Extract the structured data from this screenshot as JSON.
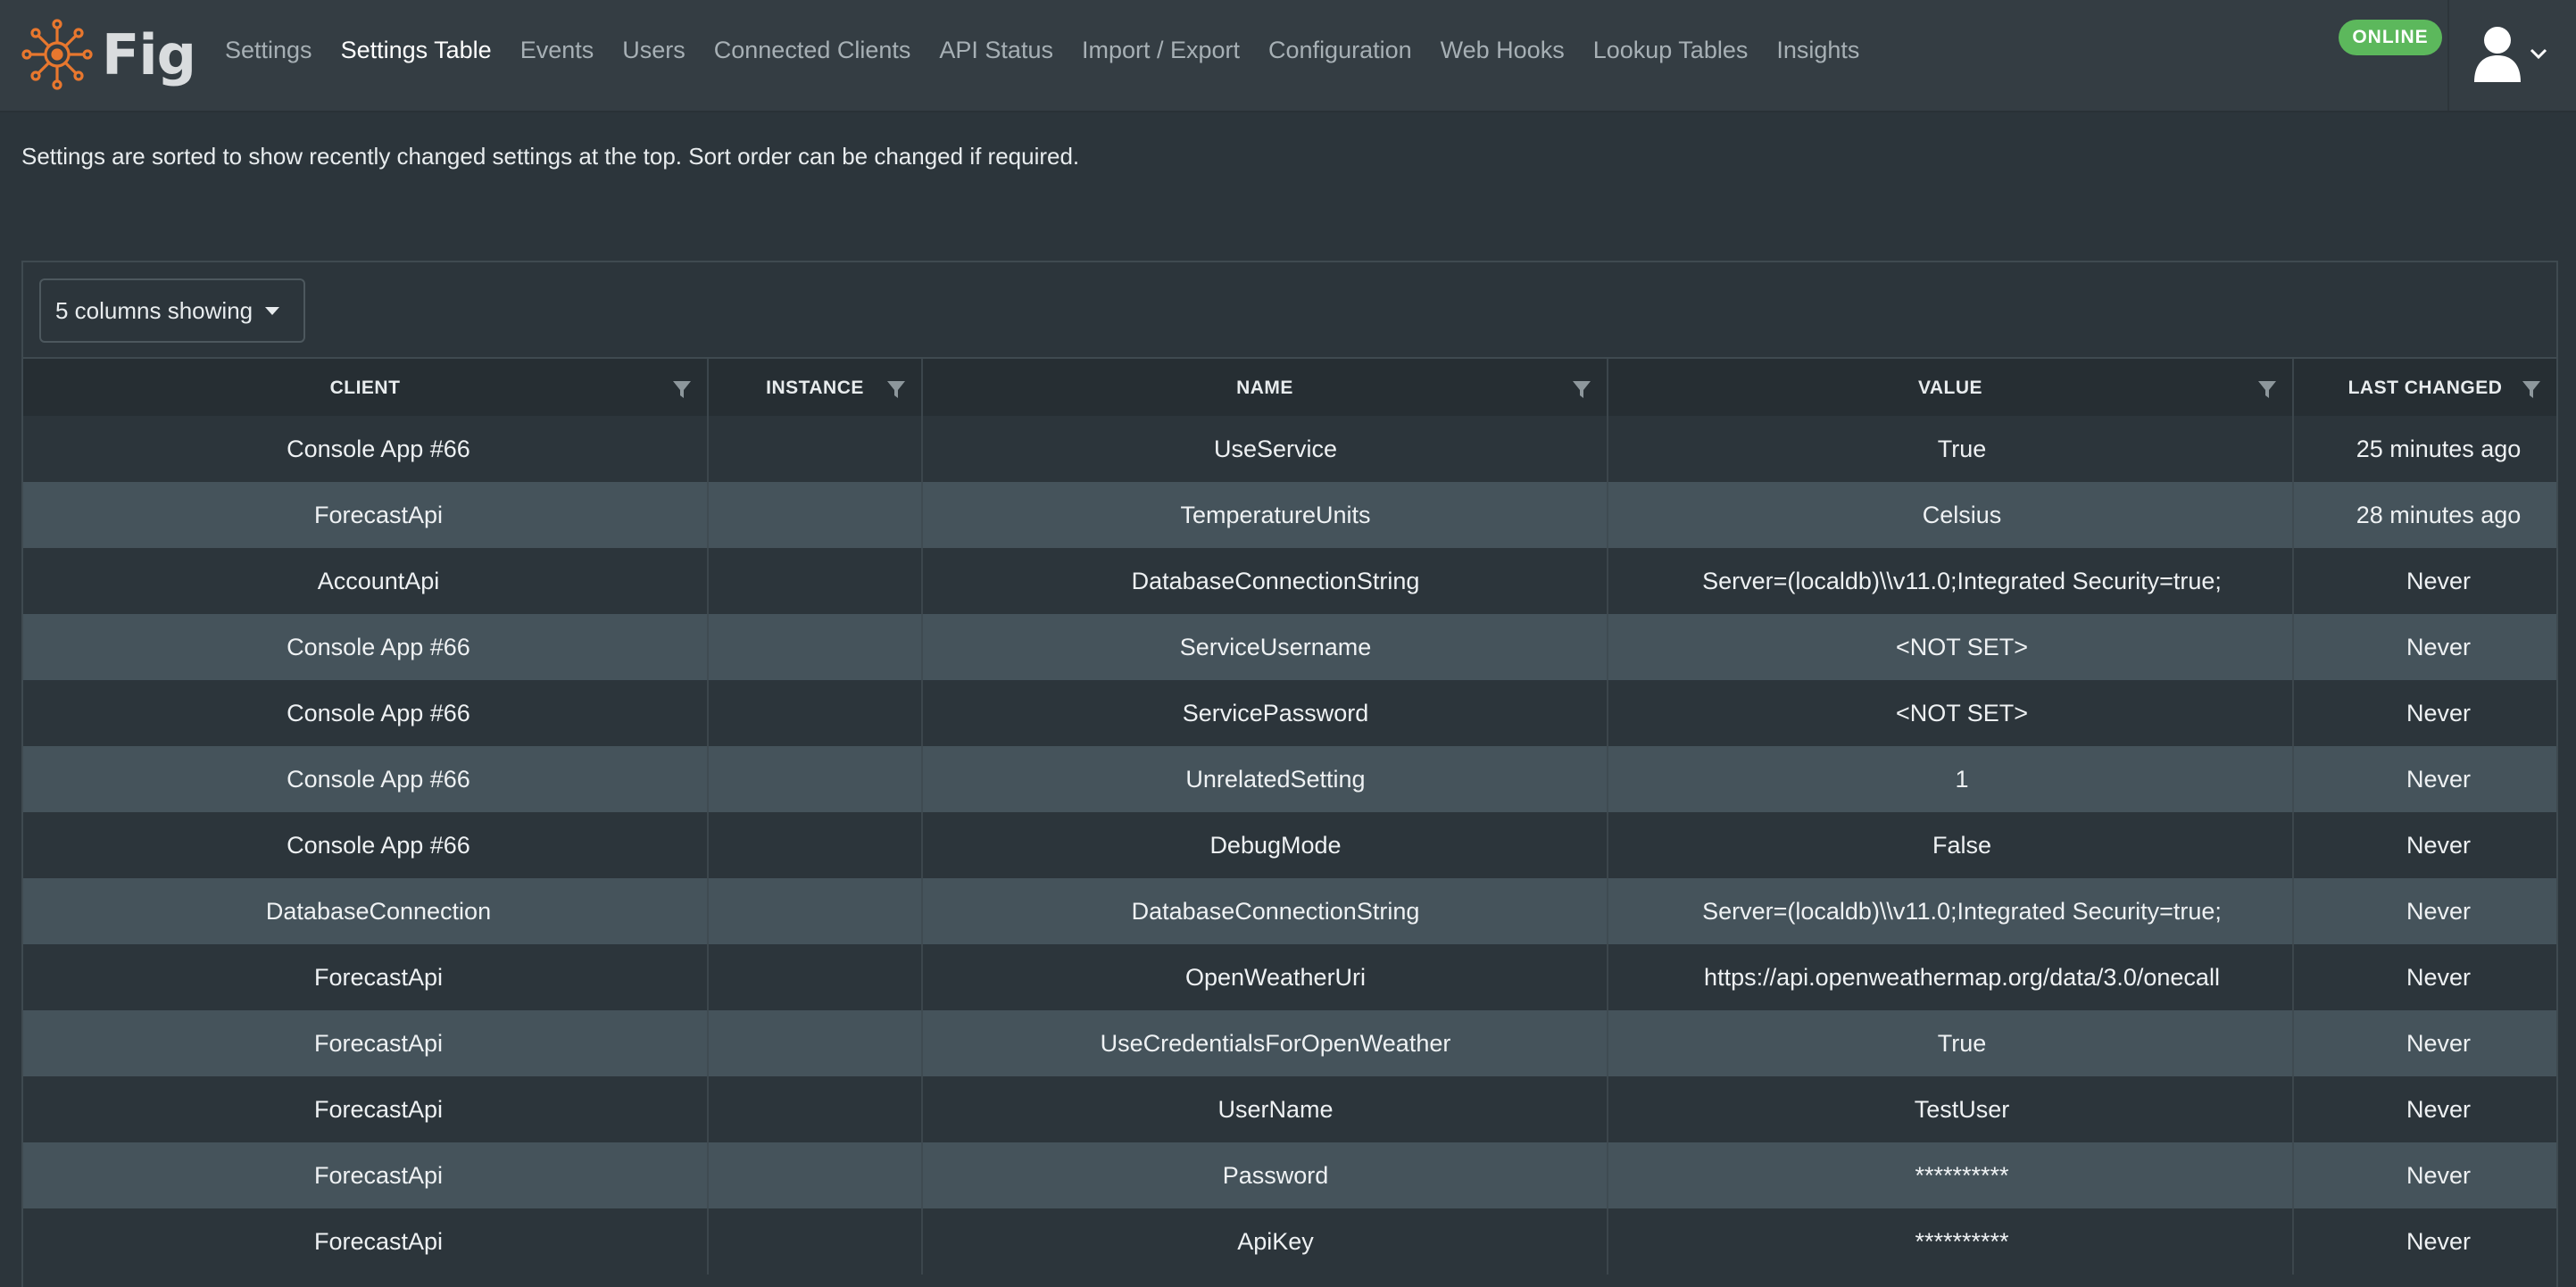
{
  "app": {
    "name": "Fig",
    "accent_color": "#e8772e",
    "status": "ONLINE",
    "status_color": "#5cb85c"
  },
  "nav": {
    "items": [
      {
        "label": "Settings",
        "active": false
      },
      {
        "label": "Settings Table",
        "active": true
      },
      {
        "label": "Events",
        "active": false
      },
      {
        "label": "Users",
        "active": false
      },
      {
        "label": "Connected Clients",
        "active": false
      },
      {
        "label": "API Status",
        "active": false
      },
      {
        "label": "Import / Export",
        "active": false
      },
      {
        "label": "Configuration",
        "active": false
      },
      {
        "label": "Web Hooks",
        "active": false
      },
      {
        "label": "Lookup Tables",
        "active": false
      },
      {
        "label": "Insights",
        "active": false
      }
    ]
  },
  "user_menu": {
    "icon": "user-icon",
    "chevron": "chevron-down-icon"
  },
  "info_text": "Settings are sorted to show recently changed settings at the top. Sort order can be changed if required.",
  "table": {
    "columns_toggle_label": "5 columns showing",
    "headers": [
      "CLIENT",
      "INSTANCE",
      "NAME",
      "VALUE",
      "LAST CHANGED"
    ],
    "rows": [
      [
        "Console App #66",
        "",
        "UseService",
        "True",
        "25 minutes ago"
      ],
      [
        "ForecastApi",
        "",
        "TemperatureUnits",
        "Celsius",
        "28 minutes ago"
      ],
      [
        "AccountApi",
        "",
        "DatabaseConnectionString",
        "Server=(localdb)\\\\v11.0;Integrated Security=true;",
        "Never"
      ],
      [
        "Console App #66",
        "",
        "ServiceUsername",
        "<NOT SET>",
        "Never"
      ],
      [
        "Console App #66",
        "",
        "ServicePassword",
        "<NOT SET>",
        "Never"
      ],
      [
        "Console App #66",
        "",
        "UnrelatedSetting",
        "1",
        "Never"
      ],
      [
        "Console App #66",
        "",
        "DebugMode",
        "False",
        "Never"
      ],
      [
        "DatabaseConnection",
        "",
        "DatabaseConnectionString",
        "Server=(localdb)\\\\v11.0;Integrated Security=true;",
        "Never"
      ],
      [
        "ForecastApi",
        "",
        "OpenWeatherUri",
        "https://api.openweathermap.org/data/3.0/onecall",
        "Never"
      ],
      [
        "ForecastApi",
        "",
        "UseCredentialsForOpenWeather",
        "True",
        "Never"
      ],
      [
        "ForecastApi",
        "",
        "UserName",
        "TestUser",
        "Never"
      ],
      [
        "ForecastApi",
        "",
        "Password",
        "**********",
        "Never"
      ],
      [
        "ForecastApi",
        "",
        "ApiKey",
        "**********",
        "Never"
      ]
    ]
  }
}
